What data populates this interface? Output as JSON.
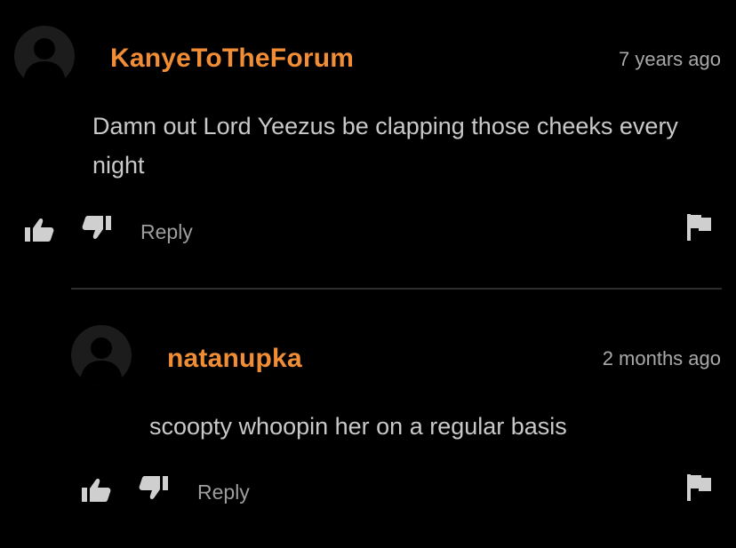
{
  "comments": [
    {
      "username": "KanyeToTheForum",
      "time": "7 years ago",
      "text": "Damn out Lord Yeezus be clapping those cheeks every night",
      "reply_label": "Reply"
    },
    {
      "username": "natanupka",
      "time": "2 months ago",
      "text": "scoopty whoopin her on a regular basis",
      "reply_label": "Reply"
    }
  ],
  "icons": {
    "avatar": "avatar-placeholder-icon",
    "like": "thumbs-up-icon",
    "dislike": "thumbs-down-icon",
    "flag": "flag-icon"
  },
  "colors": {
    "background": "#000000",
    "username": "#f08d35",
    "text": "#c9c9c9",
    "muted": "#a9a9a9",
    "icon": "#cfcfcf",
    "avatar_bg": "#1c1c1c",
    "avatar_fg": "#000000"
  }
}
